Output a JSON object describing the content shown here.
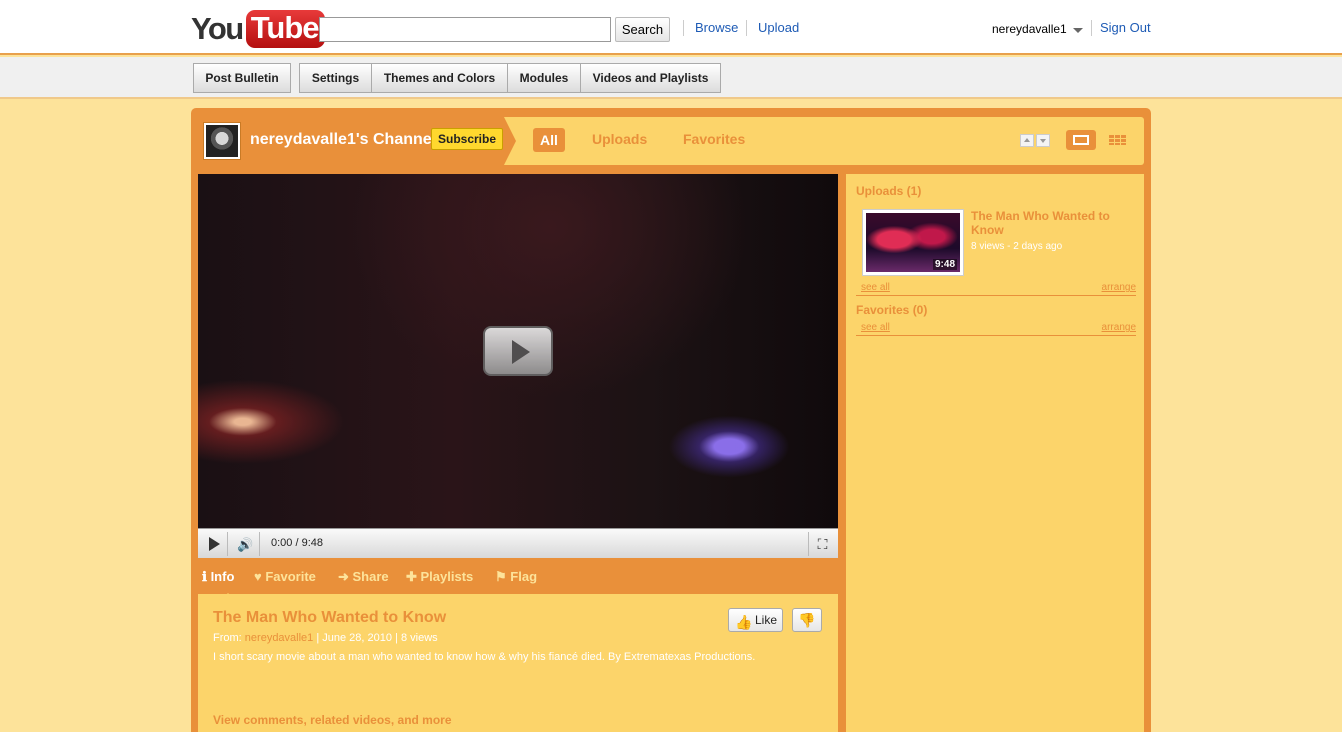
{
  "header": {
    "logo": {
      "you": "You",
      "tube": "Tube"
    },
    "search": {
      "value": "",
      "button": "Search"
    },
    "links": {
      "browse": "Browse",
      "upload": "Upload"
    },
    "user": {
      "name": "nereydavalle1",
      "sign_out": "Sign Out"
    }
  },
  "editbar": {
    "post_bulletin": "Post Bulletin",
    "settings": "Settings",
    "themes": "Themes and Colors",
    "modules": "Modules",
    "videos_playlists": "Videos and Playlists"
  },
  "channel": {
    "title": "nereydavalle1's Channel",
    "subscribe": "Subscribe",
    "nav": {
      "all": "All",
      "uploads": "Uploads",
      "favorites": "Favorites"
    }
  },
  "player": {
    "time": "0:00 / 9:48"
  },
  "tabs": {
    "info": "Info",
    "favorite": "Favorite",
    "share": "Share",
    "playlists": "Playlists",
    "flag": "Flag"
  },
  "video": {
    "title": "The Man Who Wanted to Know",
    "from_label": "From:",
    "author": "nereydavalle1",
    "date_views": "| June 28, 2010 | 8 views",
    "description": "I short scary movie about a man who wanted to know how & why his fiancé died. By Extrematexas Productions.",
    "more": "View comments, related videos, and more",
    "like": "Like"
  },
  "sidebar": {
    "uploads_head": "Uploads (1)",
    "favorites_head": "Favorites (0)",
    "item": {
      "title": "The Man Who Wanted to Know",
      "meta": "8 views - 2 days ago",
      "duration": "9:48"
    },
    "see_all": "see all",
    "arrange": "arrange"
  },
  "colors": {
    "accent": "#e9903a",
    "panel": "#fcd46a",
    "background": "#fde39a",
    "link": "#1e5bb5"
  }
}
